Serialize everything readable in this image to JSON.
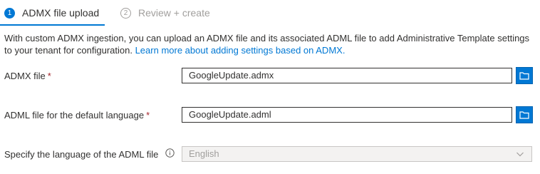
{
  "steps": [
    {
      "number": "1",
      "label": "ADMX file upload"
    },
    {
      "number": "2",
      "label": "Review + create"
    }
  ],
  "description": {
    "text": "With custom ADMX ingestion, you can upload an ADMX file and its associated ADML file to add Administrative Template settings to your tenant for configuration.",
    "link": "Learn more about adding settings based on ADMX."
  },
  "fields": {
    "admx": {
      "label": "ADMX file",
      "required_mark": "*",
      "value": "GoogleUpdate.admx"
    },
    "adml": {
      "label": "ADML file for the default language",
      "required_mark": "*",
      "value": "GoogleUpdate.adml"
    },
    "language": {
      "label": "Specify the language of the ADML file",
      "value": "English"
    }
  },
  "icons": {
    "browse": "folder-icon",
    "info": "info-icon",
    "dropdown": "chevron-down-icon"
  },
  "colors": {
    "accent": "#0078d4",
    "required": "#a4262c",
    "disabled_text": "#a19f9d"
  }
}
